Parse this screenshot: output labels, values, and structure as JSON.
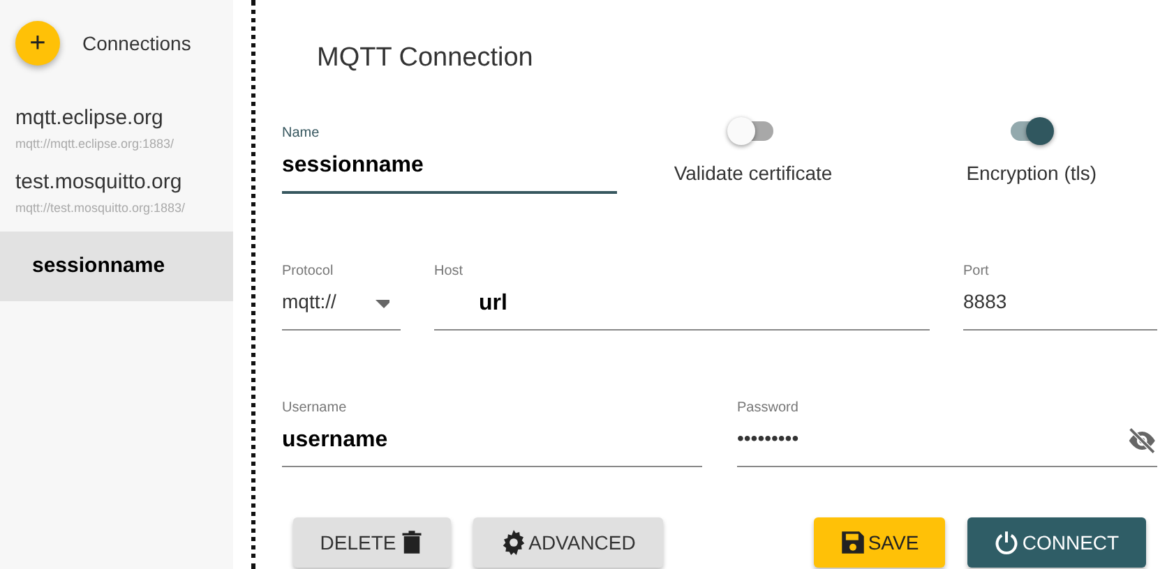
{
  "sidebar": {
    "add_button": "+",
    "title": "Connections",
    "connections": [
      {
        "name": "mqtt.eclipse.org",
        "url": "mqtt://mqtt.eclipse.org:1883/",
        "selected": false
      },
      {
        "name": "test.mosquitto.org",
        "url": "mqtt://test.mosquitto.org:1883/",
        "selected": false
      },
      {
        "name": "sessionname",
        "selected": true
      }
    ]
  },
  "form": {
    "title": "MQTT Connection",
    "name": {
      "label": "Name",
      "value": "sessionname",
      "focused": true
    },
    "toggles": [
      {
        "label": "Validate certificate",
        "on": false
      },
      {
        "label": "Encryption (tls)",
        "on": true
      }
    ],
    "protocol": {
      "label": "Protocol",
      "value": "mqtt://"
    },
    "host": {
      "label": "Host",
      "value": "url"
    },
    "port": {
      "label": "Port",
      "value": "8883"
    },
    "username": {
      "label": "Username",
      "value": "username"
    },
    "password": {
      "label": "Password",
      "value": "•••••••••"
    }
  },
  "buttons": [
    {
      "label": "DELETE",
      "kind": "delete"
    },
    {
      "label": "ADVANCED",
      "kind": "advanced"
    },
    {
      "label": "SAVE",
      "kind": "save"
    },
    {
      "label": "CONNECT",
      "kind": "connect"
    }
  ]
}
